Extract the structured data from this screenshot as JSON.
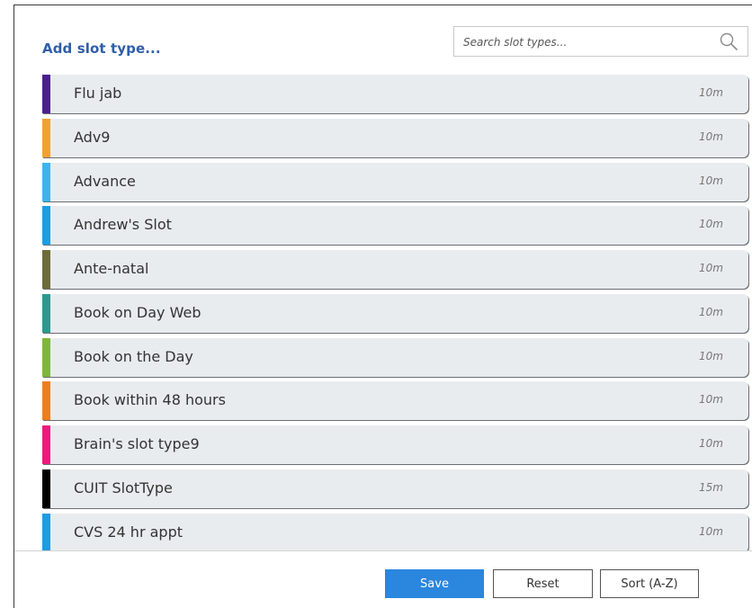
{
  "header": {
    "title": "Add slot type..."
  },
  "search": {
    "placeholder": "Search slot types..."
  },
  "slot_types": [
    {
      "name": "Flu jab",
      "duration": "10m",
      "color": "#4b1f8f"
    },
    {
      "name": "Adv9",
      "duration": "10m",
      "color": "#f4a12c"
    },
    {
      "name": "Advance",
      "duration": "10m",
      "color": "#3bb5f0"
    },
    {
      "name": "Andrew's Slot",
      "duration": "10m",
      "color": "#1a9ee6"
    },
    {
      "name": "Ante-natal",
      "duration": "10m",
      "color": "#6e6b3a"
    },
    {
      "name": "Book on Day Web",
      "duration": "10m",
      "color": "#2a9a8e"
    },
    {
      "name": "Book on the Day",
      "duration": "10m",
      "color": "#7db83a"
    },
    {
      "name": "Book within 48 hours",
      "duration": "10m",
      "color": "#f07d1c"
    },
    {
      "name": "Brain's slot type9",
      "duration": "10m",
      "color": "#f0177d"
    },
    {
      "name": "CUIT SlotType",
      "duration": "15m",
      "color": "#000000"
    },
    {
      "name": "CVS 24 hr appt",
      "duration": "10m",
      "color": "#1a9ee6"
    }
  ],
  "buttons": {
    "save": "Save",
    "reset": "Reset",
    "sort": "Sort (A-Z)"
  },
  "colors": {
    "accent": "#2b86de",
    "title": "#2f5ea8",
    "row_bg": "#e8ecef"
  }
}
